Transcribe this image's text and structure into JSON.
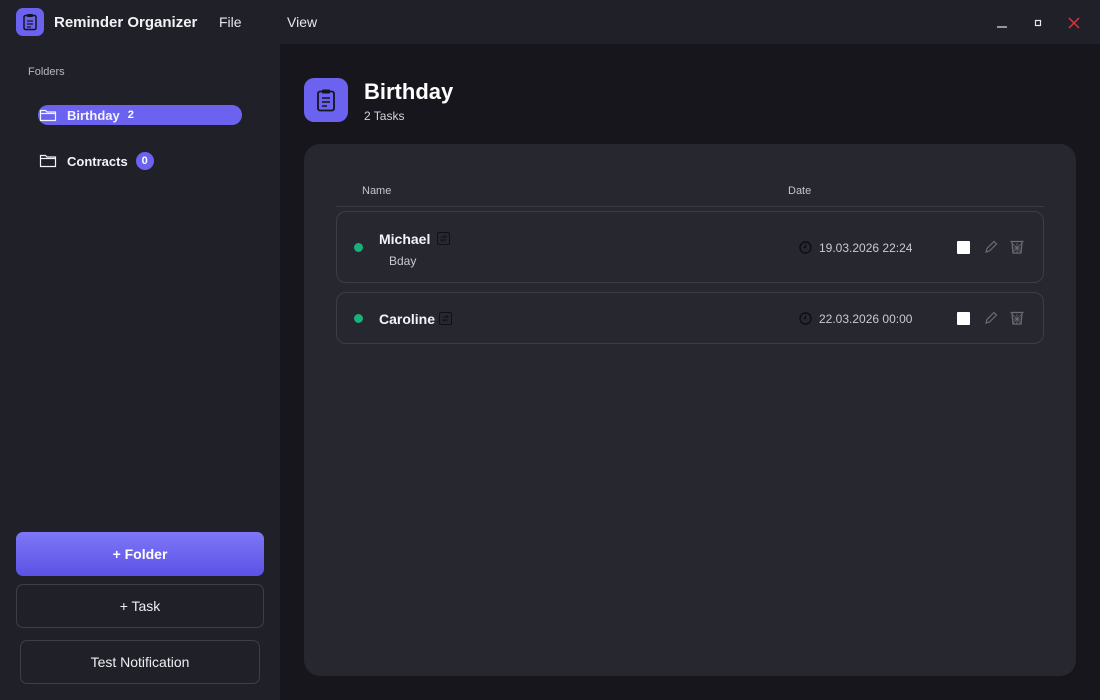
{
  "app": {
    "title": "Reminder Organizer",
    "logo_icon": "clipboard-icon",
    "accent_color": "#6b63f0"
  },
  "menu": {
    "items": [
      "File",
      "View"
    ]
  },
  "window_controls": [
    "minimize-icon",
    "maximize-icon",
    "close-icon"
  ],
  "sidebar": {
    "section_label": "Folders",
    "folders": [
      {
        "name": "Birthday",
        "count": "2",
        "active": true,
        "icon": "folder-open-icon"
      },
      {
        "name": "Contracts",
        "count": "0",
        "active": false,
        "icon": "folder-icon"
      }
    ],
    "buttons": {
      "add_folder": "+ Folder",
      "add_task": "+ Task",
      "test_notification": "Test Notification"
    }
  },
  "main": {
    "folder_title": "Birthday",
    "folder_subtitle": "2 Tasks",
    "columns": {
      "name": "Name",
      "date": "Date"
    },
    "tasks": [
      {
        "name": "Michael",
        "note": "Bday",
        "date": "19.03.2026 22:24",
        "status_color": "#19b07a",
        "repeat_icon": "repeat-icon"
      },
      {
        "name": "Caroline",
        "note": "",
        "date": "22.03.2026 00:00",
        "status_color": "#19b07a",
        "repeat_icon": "repeat-icon"
      }
    ]
  }
}
